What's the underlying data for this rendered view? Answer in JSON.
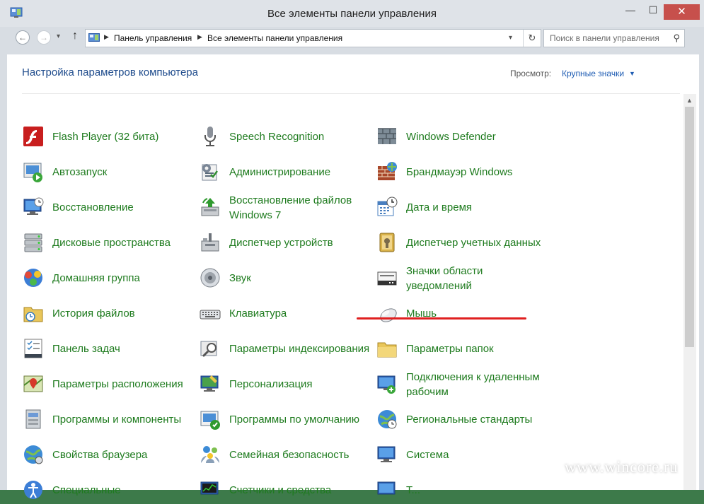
{
  "window": {
    "title": "Все элементы панели управления",
    "close_glyph": "✕",
    "min_glyph": "—",
    "max_glyph": "☐"
  },
  "nav": {
    "back": "←",
    "forward": "→",
    "history": "▾",
    "up": "↑",
    "breadcrumb": [
      "Панель управления",
      "Все элементы панели управления"
    ],
    "search_placeholder": "Поиск в панели управления"
  },
  "header": {
    "title": "Настройка параметров компьютера",
    "view_label": "Просмотр:",
    "view_value": "Крупные значки"
  },
  "columns": [
    [
      {
        "label": "Flash Player (32 бита)",
        "icon": "flash-icon"
      },
      {
        "label": "Автозапуск",
        "icon": "autoplay-icon"
      },
      {
        "label": "Восстановление",
        "icon": "recovery-icon"
      },
      {
        "label": "Дисковые пространства",
        "icon": "storage-spaces-icon"
      },
      {
        "label": "Домашняя группа",
        "icon": "homegroup-icon"
      },
      {
        "label": "История файлов",
        "icon": "file-history-icon"
      },
      {
        "label": "Панель задач",
        "icon": "taskbar-icon"
      },
      {
        "label": "Параметры расположения",
        "icon": "location-icon"
      },
      {
        "label": "Программы и компоненты",
        "icon": "programs-icon"
      },
      {
        "label": "Свойства браузера",
        "icon": "internet-options-icon"
      },
      {
        "label": "Специальные",
        "icon": "accessibility-icon"
      }
    ],
    [
      {
        "label": "Speech Recognition",
        "icon": "microphone-icon"
      },
      {
        "label": "Администрирование",
        "icon": "admin-tools-icon"
      },
      {
        "label": "Восстановление файлов Windows 7",
        "icon": "backup-icon"
      },
      {
        "label": "Диспетчер устройств",
        "icon": "device-manager-icon"
      },
      {
        "label": "Звук",
        "icon": "speaker-icon"
      },
      {
        "label": "Клавиатура",
        "icon": "keyboard-icon"
      },
      {
        "label": "Параметры индексирования",
        "icon": "indexing-icon"
      },
      {
        "label": "Персонализация",
        "icon": "personalization-icon"
      },
      {
        "label": "Программы по умолчанию",
        "icon": "default-programs-icon"
      },
      {
        "label": "Семейная безопасность",
        "icon": "family-safety-icon"
      },
      {
        "label": "Счетчики и средства",
        "icon": "performance-icon"
      }
    ],
    [
      {
        "label": "Windows Defender",
        "icon": "defender-icon"
      },
      {
        "label": "Брандмауэр Windows",
        "icon": "firewall-icon"
      },
      {
        "label": "Дата и время",
        "icon": "date-time-icon"
      },
      {
        "label": "Диспетчер учетных данных",
        "icon": "credential-manager-icon"
      },
      {
        "label": "Значки области уведомлений",
        "icon": "notification-icons-icon"
      },
      {
        "label": "Мышь",
        "icon": "mouse-icon"
      },
      {
        "label": "Параметры папок",
        "icon": "folder-options-icon"
      },
      {
        "label": "Подключения к удаленным рабочим",
        "icon": "remote-desktop-icon"
      },
      {
        "label": "Региональные стандарты",
        "icon": "region-icon"
      },
      {
        "label": "Система",
        "icon": "system-icon"
      },
      {
        "label": "Т...",
        "icon": "troubleshoot-icon"
      }
    ]
  ],
  "watermark": "www.wincore.ru"
}
